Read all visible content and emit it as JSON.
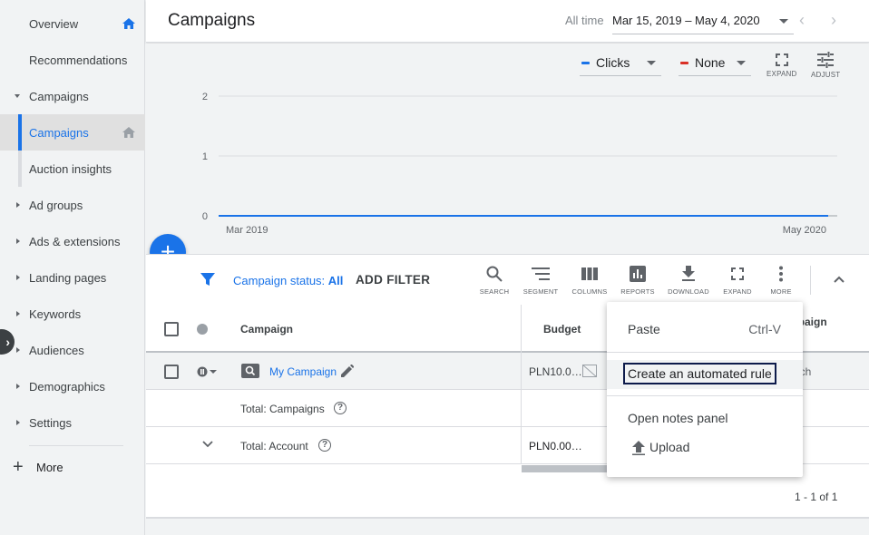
{
  "sidebar": {
    "items": [
      {
        "label": "Overview",
        "home": true,
        "home_color": "#1a73e8"
      },
      {
        "label": "Recommendations"
      },
      {
        "label": "Campaigns",
        "expanded": true
      },
      {
        "label": "Campaigns",
        "active": true,
        "home": true,
        "home_color": "#9aa0a6"
      },
      {
        "label": "Auction insights"
      },
      {
        "label": "Ad groups"
      },
      {
        "label": "Ads & extensions"
      },
      {
        "label": "Landing pages"
      },
      {
        "label": "Keywords"
      },
      {
        "label": "Audiences"
      },
      {
        "label": "Demographics"
      },
      {
        "label": "Settings"
      }
    ],
    "more_label": "More",
    "collapse_glyph": "›"
  },
  "header": {
    "title": "Campaigns",
    "date_label": "All time",
    "date_range": "Mar 15, 2019 – May 4, 2020",
    "prev_glyph": "‹",
    "next_glyph": "›"
  },
  "chart_controls": {
    "metric1": {
      "label": "Clicks",
      "color": "#1a73e8"
    },
    "metric2": {
      "label": "None",
      "color": "#d93025"
    },
    "expand_label": "EXPAND",
    "adjust_label": "ADJUST"
  },
  "chart_data": {
    "type": "line",
    "x_labels": [
      "Mar 2019",
      "May 2020"
    ],
    "yticks": [
      "2",
      "1",
      "0"
    ],
    "ylim": [
      0,
      2
    ],
    "series": [
      {
        "values": [
          0,
          0
        ],
        "color": "#1a73e8"
      }
    ],
    "grid": true
  },
  "fab": {
    "glyph": "+"
  },
  "filter_bar": {
    "status_label": "Campaign status:",
    "status_value": "All",
    "add_filter": "ADD FILTER",
    "tools": [
      {
        "label": "SEARCH",
        "icon": "search-icon"
      },
      {
        "label": "SEGMENT",
        "icon": "segment-icon"
      },
      {
        "label": "COLUMNS",
        "icon": "columns-icon"
      },
      {
        "label": "REPORTS",
        "icon": "reports-icon"
      },
      {
        "label": "DOWNLOAD",
        "icon": "download-icon"
      },
      {
        "label": "EXPAND",
        "icon": "expand-icon"
      },
      {
        "label": "MORE",
        "icon": "more-vert-icon"
      }
    ]
  },
  "table": {
    "headers": {
      "campaign": "Campaign",
      "budget": "Budget",
      "campaign_type_partial": "mpaign\npe"
    },
    "rows": [
      {
        "campaign": "My Campaign",
        "budget": "PLN10.0…",
        "type_partial": "arch"
      },
      {
        "campaign": "Total: Campaigns",
        "budget": ""
      },
      {
        "campaign": "Total: Account",
        "budget": "PLN0.00…"
      }
    ],
    "pager": "1 - 1 of 1"
  },
  "context_menu": {
    "items": [
      {
        "label": "Paste",
        "shortcut": "Ctrl-V"
      },
      {
        "label": "Create an automated rule",
        "focused": true
      },
      {
        "label": "Open notes panel"
      },
      {
        "label": "Upload"
      }
    ]
  }
}
